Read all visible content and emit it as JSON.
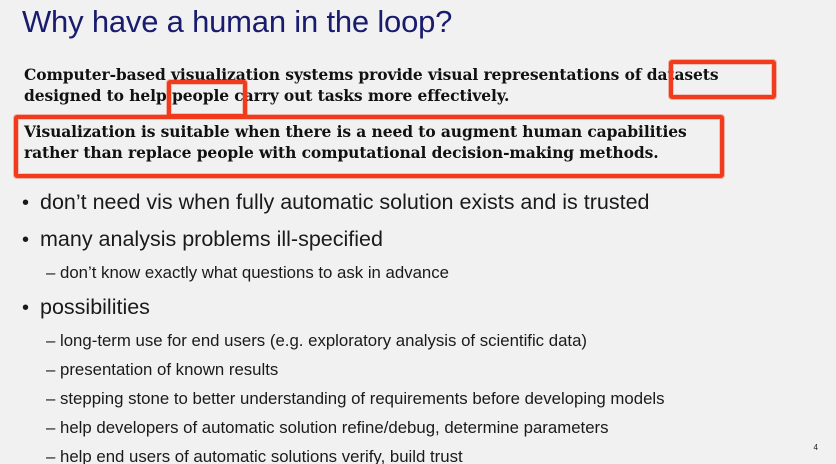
{
  "slide": {
    "title": "Why have a human in the loop?",
    "quote1": {
      "line1": "Computer-based visualization systems provide visual representations of datasets",
      "line2": "designed to help people carry out tasks more effectively."
    },
    "quote2": {
      "line1": "Visualization is suitable when there is a need to augment human capabilities",
      "line2": "rather than replace people with computational decision-making methods."
    },
    "bullets": [
      {
        "text": "don’t need vis when fully automatic solution exists and is trusted",
        "sub": []
      },
      {
        "text": "many analysis problems ill-specified",
        "sub": [
          "don’t know exactly what questions to ask in advance"
        ]
      },
      {
        "text": "possibilities",
        "sub": [
          "long-term use for end users (e.g. exploratory analysis of scientific data)",
          "presentation of known results",
          "stepping stone to better understanding of requirements before developing models",
          "help developers of automatic solution refine/debug, determine parameters",
          "help end users of automatic solutions verify, build trust"
        ]
      }
    ],
    "bullet_glyph": "•",
    "sub_glyph": "–",
    "page_number": "4"
  },
  "colors": {
    "title": "#191b6e",
    "highlight": "#f23a1c",
    "background": "#f1f1f1"
  }
}
